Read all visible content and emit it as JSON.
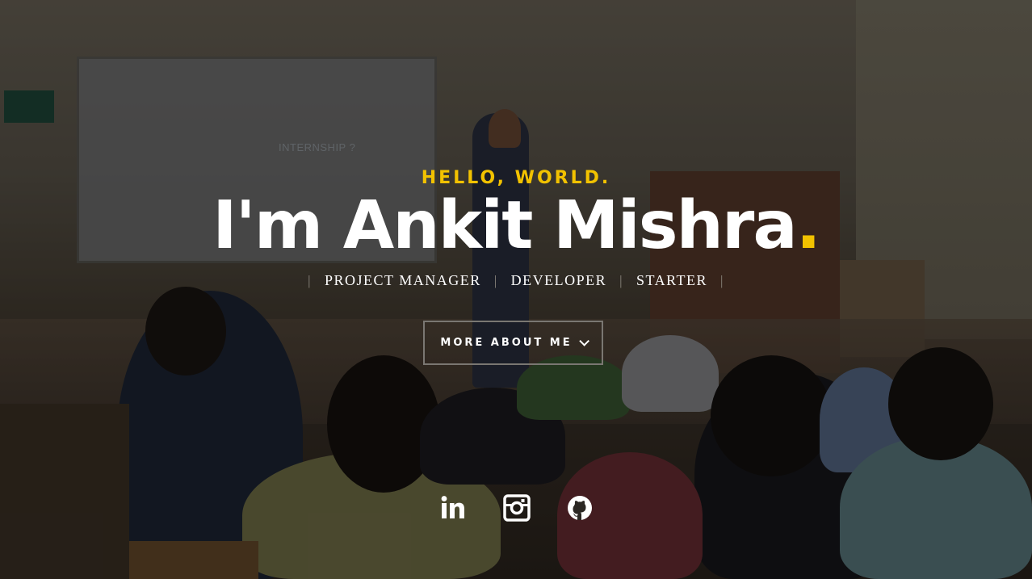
{
  "hero": {
    "greeting": "HELLO, WORLD.",
    "name": "I'm Ankit Mishra",
    "name_dot": ".",
    "roles": [
      "PROJECT MANAGER",
      "DEVELOPER",
      "STARTER"
    ],
    "role_separator": "|",
    "cta_label": "MORE ABOUT ME",
    "background_board_text": "INTERNSHIP ?"
  },
  "social": [
    {
      "name": "linkedin",
      "icon": "linkedin-icon"
    },
    {
      "name": "instagram",
      "icon": "instagram-icon"
    },
    {
      "name": "github",
      "icon": "github-icon"
    }
  ],
  "colors": {
    "accent": "#f2c200",
    "text": "#ffffff",
    "separator": "#8c877e",
    "button_border": "#7a7772"
  }
}
